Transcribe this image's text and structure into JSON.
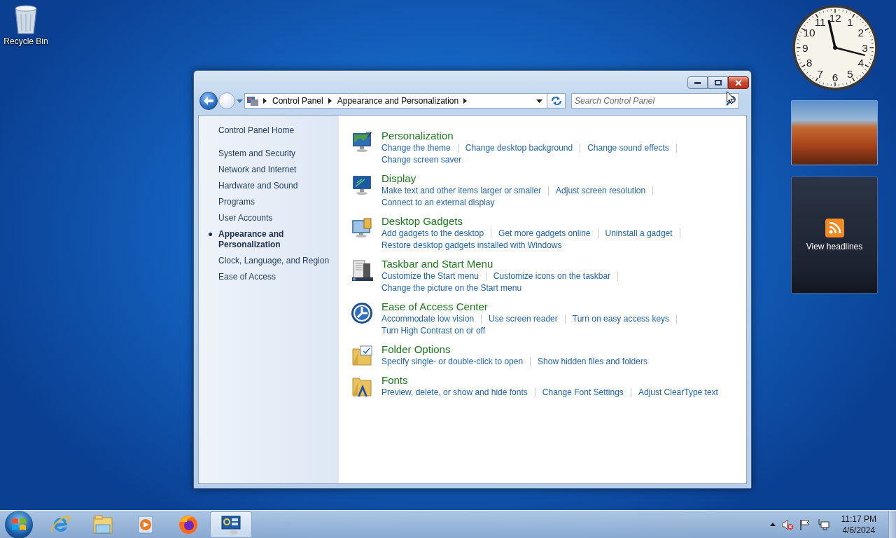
{
  "desktop_icons": [
    {
      "label": "Recycle Bin"
    }
  ],
  "window": {
    "breadcrumb": [
      "Control Panel",
      "Appearance and Personalization"
    ],
    "search": {
      "placeholder": "Search Control Panel"
    },
    "sidebar": {
      "home": "Control Panel Home",
      "items": [
        {
          "label": "System and Security",
          "selected": false
        },
        {
          "label": "Network and Internet",
          "selected": false
        },
        {
          "label": "Hardware and Sound",
          "selected": false
        },
        {
          "label": "Programs",
          "selected": false
        },
        {
          "label": "User Accounts",
          "selected": false
        },
        {
          "label": "Appearance and Personalization",
          "selected": true
        },
        {
          "label": "Clock, Language, and Region",
          "selected": false
        },
        {
          "label": "Ease of Access",
          "selected": false
        }
      ]
    },
    "categories": [
      {
        "kind": "personalization",
        "title": "Personalization",
        "links": [
          "Change the theme",
          "Change desktop background",
          "Change sound effects",
          "Change screen saver"
        ]
      },
      {
        "kind": "display",
        "title": "Display",
        "links": [
          "Make text and other items larger or smaller",
          "Adjust screen resolution",
          "Connect to an external display"
        ]
      },
      {
        "kind": "gadgets",
        "title": "Desktop Gadgets",
        "links": [
          "Add gadgets to the desktop",
          "Get more gadgets online",
          "Uninstall a gadget",
          "Restore desktop gadgets installed with Windows"
        ]
      },
      {
        "kind": "taskbar",
        "title": "Taskbar and Start Menu",
        "links": [
          "Customize the Start menu",
          "Customize icons on the taskbar",
          "Change the picture on the Start menu"
        ]
      },
      {
        "kind": "ease",
        "title": "Ease of Access Center",
        "links": [
          "Accommodate low vision",
          "Use screen reader",
          "Turn on easy access keys",
          "Turn High Contrast on or off"
        ]
      },
      {
        "kind": "folder",
        "title": "Folder Options",
        "links": [
          "Specify single- or double-click to open",
          "Show hidden files and folders"
        ]
      },
      {
        "kind": "fonts",
        "title": "Fonts",
        "links": [
          "Preview, delete, or show and hide fonts",
          "Change Font Settings",
          "Adjust ClearType text"
        ]
      }
    ]
  },
  "gadgets": {
    "clock": {
      "numerals": [
        "11",
        "12",
        "1",
        "10",
        "2",
        "9",
        "3",
        "8",
        "4",
        "7",
        "5",
        "6"
      ]
    },
    "feed": {
      "label": "View headlines"
    }
  },
  "taskbar": {
    "apps": [
      {
        "kind": "ie",
        "selected": false
      },
      {
        "kind": "explorer",
        "selected": false
      },
      {
        "kind": "media",
        "selected": false
      },
      {
        "kind": "firefox",
        "selected": false
      },
      {
        "kind": "controlpanel",
        "selected": true
      }
    ],
    "clock": {
      "time": "11:17 PM",
      "date": "4/6/2024"
    }
  }
}
